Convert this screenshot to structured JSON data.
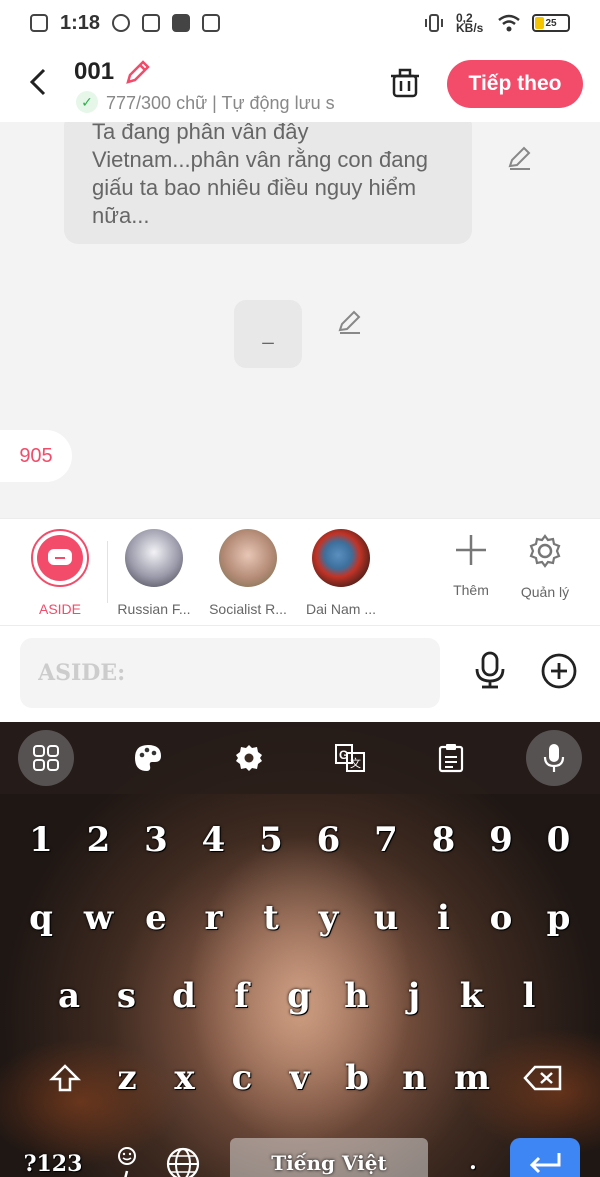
{
  "status_bar": {
    "time": "1:18",
    "battery": "25",
    "network": "0,2 KB/s"
  },
  "header": {
    "title": "001",
    "status": "777/300 chữ | Tự động lưu s",
    "next_label": "Tiếp theo"
  },
  "chat": {
    "message_text": "Ta đang phân vân đây Vietnam...phân vân rằng con đang giấu ta bao nhiêu điều nguy hiểm nữa...",
    "blank_message": "_",
    "count": "905"
  },
  "characters": [
    {
      "name": "ASIDE"
    },
    {
      "name": "Russian F..."
    },
    {
      "name": "Socialist R..."
    },
    {
      "name": "Dai Nam ..."
    }
  ],
  "tools": {
    "add_label": "Thêm",
    "manage_label": "Quản lý"
  },
  "input": {
    "placeholder": "ASIDE:"
  },
  "keyboard": {
    "row_numbers": [
      "1",
      "2",
      "3",
      "4",
      "5",
      "6",
      "7",
      "8",
      "9",
      "0"
    ],
    "row1": [
      "q",
      "w",
      "e",
      "r",
      "t",
      "y",
      "u",
      "i",
      "o",
      "p"
    ],
    "row2": [
      "a",
      "s",
      "d",
      "f",
      "g",
      "h",
      "j",
      "k",
      "l"
    ],
    "row3": [
      "z",
      "x",
      "c",
      "v",
      "b",
      "n",
      "m"
    ],
    "symbols_label": "?123",
    "space_label": "Tiếng Việt",
    "period": "."
  },
  "colors": {
    "accent": "#f24c6a",
    "enter": "#3f86f5"
  }
}
